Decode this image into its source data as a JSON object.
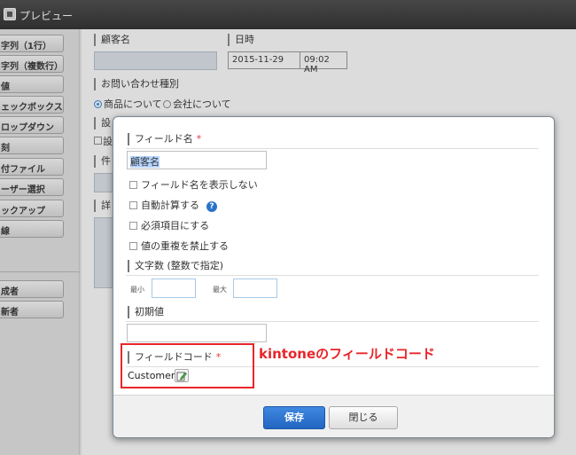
{
  "window": {
    "title": "プレビュー"
  },
  "palette": {
    "items": [
      "字列（1行）",
      "字列（複数行）",
      "値",
      "ェックボックス",
      "ロップダウン",
      "刻",
      "付ファイル",
      "ーザー選択",
      "ックアップ",
      "線"
    ],
    "bottom_items": [
      "成者",
      "新者"
    ]
  },
  "background_form": {
    "customer_label": "顧客名",
    "datetime_label": "日時",
    "date_value": "2015-11-29",
    "time_value": "09:02 AM",
    "inquiry_label": "お問い合わせ種別",
    "radio_product": "商品について",
    "radio_company": "会社について",
    "partial_1": "設",
    "partial_2": "設",
    "partial_3": "件",
    "partial_4": "詳"
  },
  "dialog": {
    "field_name_label": "フィールド名",
    "required_mark": "*",
    "field_name_value": "顧客名",
    "options": [
      "フィールド名を表示しない",
      "自動計算する",
      "必須項目にする",
      "値の重複を禁止する"
    ],
    "help_glyph": "?",
    "char_count_label": "文字数 (整数で指定)",
    "min_label": "最小",
    "max_label": "最大",
    "default_label": "初期値",
    "field_code_label": "フィールドコード",
    "field_code_value": "Customer",
    "save_button": "保存",
    "close_button": "閉じる"
  },
  "annotation": {
    "text": "kintoneのフィールドコード",
    "color": "#e8262a"
  },
  "colors": {
    "primary_button": "#2a72c8",
    "required": "#e03a3a",
    "topbar": "#3a3a3a"
  }
}
